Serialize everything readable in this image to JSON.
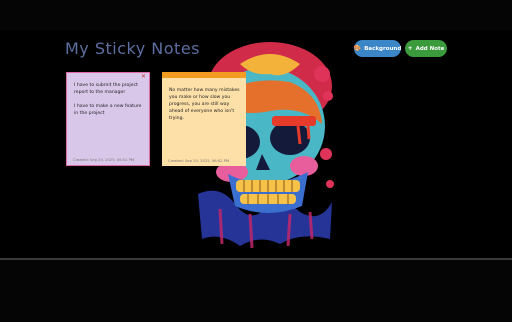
{
  "app": {
    "title": "My Sticky Notes"
  },
  "toolbar": {
    "background_label": "Background",
    "background_icon": "palette-icon",
    "add_label": "Add Note",
    "add_icon": "plus-icon"
  },
  "notes": [
    {
      "text": "I have to submit the project report to the manager\n\nI have to make a new feature in the project",
      "created": "Created: Sep 20, 2025, 06:01 PM",
      "color": "#d9c7ea"
    },
    {
      "text": "No matter how many mistakes you make or how slow you progress, you are still way ahead of everyone who isn't trying.",
      "created": "Created: Sep 20, 2025, 06:02 PM",
      "color": "#fde0a8"
    }
  ],
  "colors": {
    "background_button": "#3b86c7",
    "add_button": "#3a9a3c",
    "title": "#5f6ea0"
  }
}
